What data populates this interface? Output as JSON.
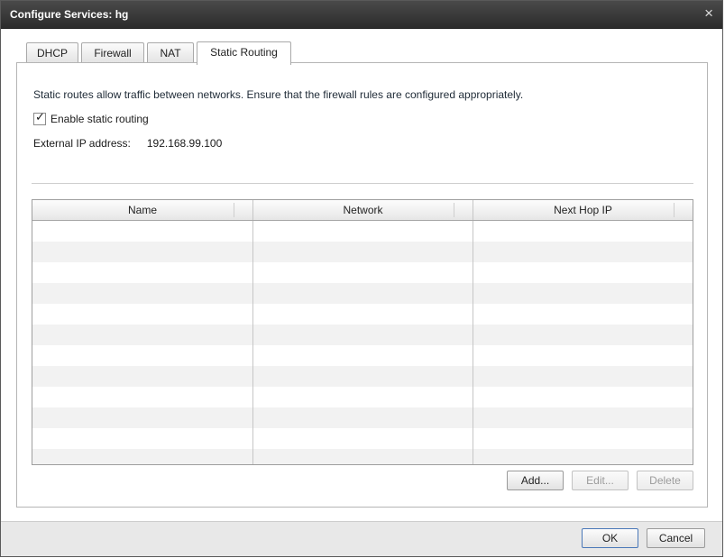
{
  "window": {
    "title": "Configure Services: hg",
    "close_glyph": "×",
    "close_icon": "close-icon"
  },
  "tabs": [
    {
      "label": "DHCP",
      "active": false
    },
    {
      "label": "Firewall",
      "active": false
    },
    {
      "label": "NAT",
      "active": false
    },
    {
      "label": "Static Routing",
      "active": true
    }
  ],
  "static_routing": {
    "description": "Static routes allow traffic between networks. Ensure that the firewall rules are configured appropriately.",
    "enable_label": "Enable static routing",
    "enable_checked": true,
    "check_glyph": "✓",
    "external_ip_label": "External IP address:",
    "external_ip_value": "192.168.99.100"
  },
  "routes_table": {
    "columns": [
      "Name",
      "Network",
      "Next Hop IP"
    ],
    "rows": []
  },
  "table_buttons": {
    "add": "Add...",
    "edit": "Edit...",
    "delete": "Delete"
  },
  "footer": {
    "ok": "OK",
    "cancel": "Cancel"
  }
}
